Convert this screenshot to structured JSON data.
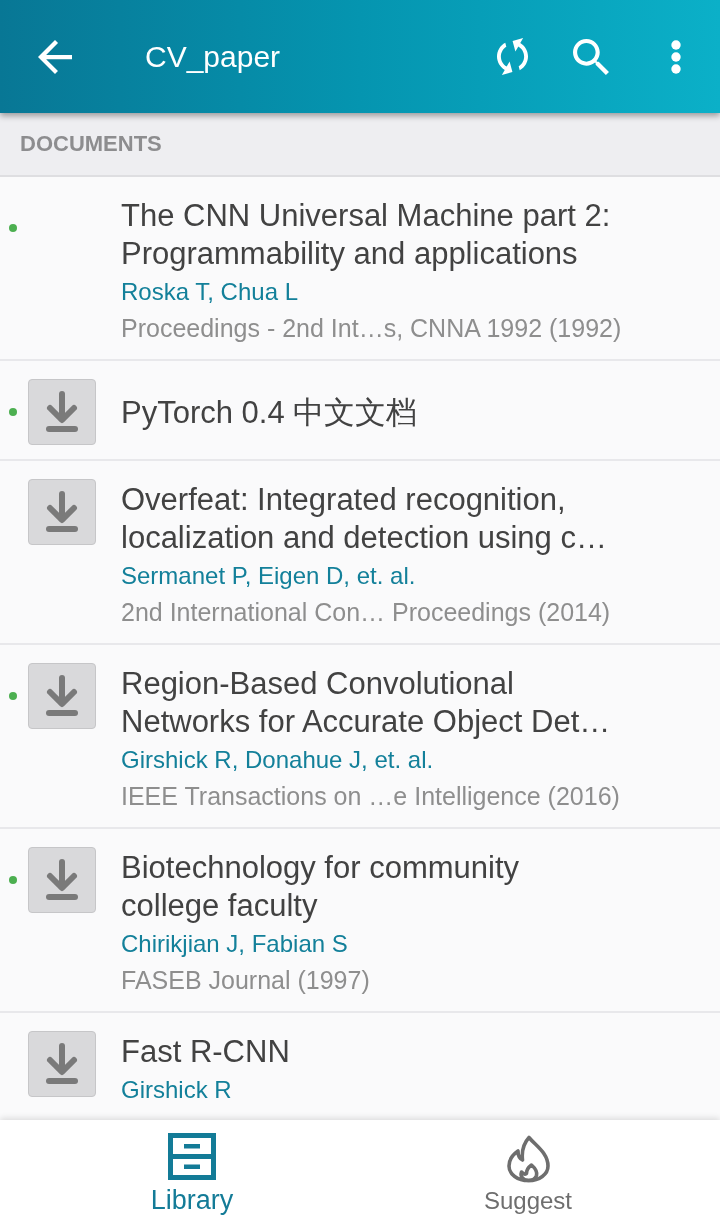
{
  "app_bar": {
    "title": "CV_paper"
  },
  "section": {
    "title": "DOCUMENTS"
  },
  "documents": [
    {
      "title": "The CNN Universal Machine part 2: Programmability and applications",
      "authors": "Roska T, Chua L",
      "source": "Proceedings - 2nd Int…s, CNNA 1992 (1992)",
      "unread": true,
      "download_available": false
    },
    {
      "title": "PyTorch 0.4 中文文档",
      "unread": true,
      "download_available": true
    },
    {
      "title": "Overfeat: Integrated recognition, localization and detection using c…",
      "authors": "Sermanet P, Eigen D, et. al.",
      "source": "2nd International Con… Proceedings (2014)",
      "unread": false,
      "download_available": true
    },
    {
      "title": "Region-Based Convolutional Networks for Accurate Object Det…",
      "authors": "Girshick R, Donahue J, et. al.",
      "source": "IEEE Transactions on …e Intelligence (2016)",
      "unread": true,
      "download_available": true
    },
    {
      "title": "Biotechnology for community college faculty",
      "authors": "Chirikjian J, Fabian S",
      "source": "FASEB Journal (1997)",
      "unread": true,
      "download_available": true
    },
    {
      "title": "Fast R-CNN",
      "authors": "Girshick R",
      "unread": false,
      "download_available": true
    }
  ],
  "bottom_nav": [
    {
      "label": "Library",
      "selected": true
    },
    {
      "label": "Suggest",
      "selected": false
    }
  ]
}
